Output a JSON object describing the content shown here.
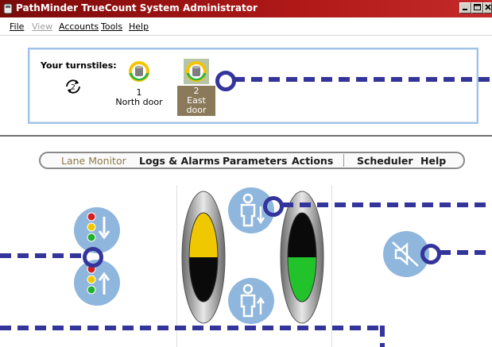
{
  "window": {
    "title": "PathMinder TrueCount System Administrator"
  },
  "menu": {
    "items": [
      {
        "label": "File",
        "enabled": true
      },
      {
        "label": "View",
        "enabled": false
      },
      {
        "label": "Accounts",
        "enabled": true
      },
      {
        "label": "Tools",
        "enabled": true
      },
      {
        "label": "Help",
        "enabled": true
      }
    ]
  },
  "turnstiles": {
    "label": "Your turnstiles:",
    "items": [
      {
        "number": "1",
        "name": "North door",
        "selected": false
      },
      {
        "number": "2",
        "name": "East door",
        "selected": true
      }
    ]
  },
  "nav": {
    "items": [
      {
        "label": "Lane Monitor",
        "active": true
      },
      {
        "label": "Logs & Alarms",
        "active": false
      },
      {
        "label": "Parameters",
        "active": false
      },
      {
        "label": "Actions",
        "active": false
      },
      {
        "label": "Scheduler",
        "active": false
      },
      {
        "label": "Help",
        "active": false
      }
    ]
  },
  "lane": {
    "left_indicator_fill": 0.5,
    "left_indicator_color": "#f0c800",
    "right_indicator_fill": 0.5,
    "right_indicator_color": "#22c32a"
  },
  "colors": {
    "accent": "#34359a",
    "title_bar": "#9c1414",
    "button_blue": "#8fb6dc",
    "panel_border": "#9fc3e8"
  }
}
